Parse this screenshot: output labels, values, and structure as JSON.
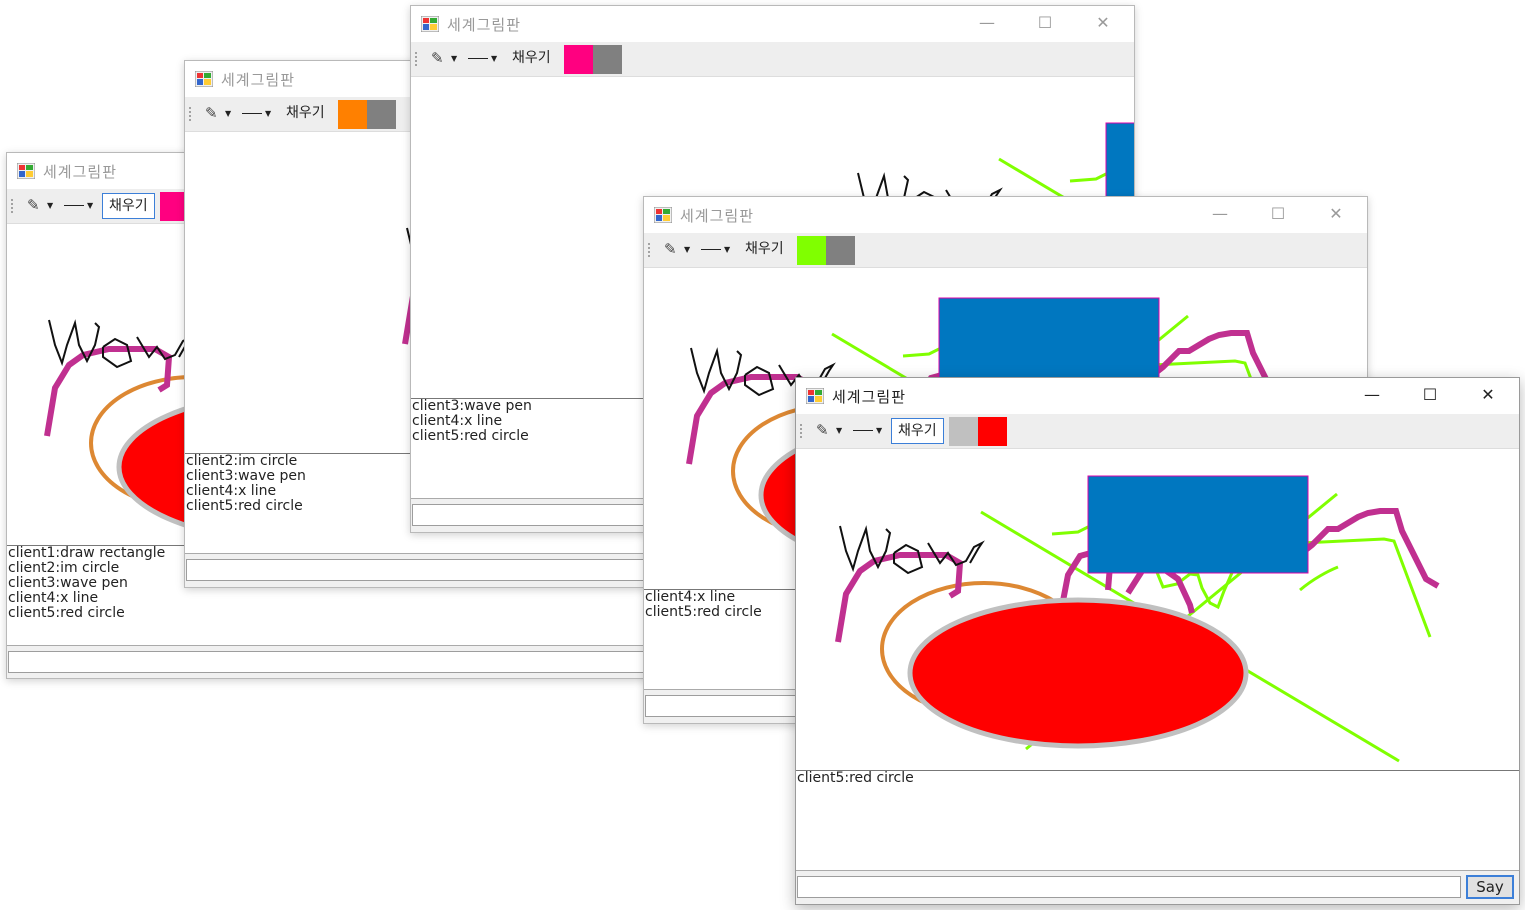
{
  "app": {
    "title": "세계그림판",
    "minimize_icon": "minimize-icon",
    "maximize_icon": "maximize-icon",
    "close_icon": "close-icon",
    "say_label": "Say"
  },
  "toolbar": {
    "pen_icon": "pen-icon",
    "line_width_icon": "line-width-icon",
    "fill_label": "채우기"
  },
  "windows": [
    {
      "id": "client1",
      "colors": [
        "#ff0080",
        "#808080"
      ],
      "log": [
        "client1:draw rectangle",
        "client2:im circle",
        "client3:wave pen",
        "client4:x line",
        "client5:red circle"
      ]
    },
    {
      "id": "client2",
      "colors": [
        "#ff8000",
        "#808080"
      ],
      "log": [
        "client2:im circle",
        "client3:wave pen",
        "client4:x line",
        "client5:red circle"
      ]
    },
    {
      "id": "client3",
      "colors": [
        "#ff0080",
        "#808080"
      ],
      "log": [
        "client3:wave pen",
        "client4:x line",
        "client5:red circle"
      ]
    },
    {
      "id": "client4",
      "colors": [
        "#80ff00",
        "#808080"
      ],
      "log": [
        "client4:x line",
        "client5:red circle"
      ]
    },
    {
      "id": "client5",
      "colors": [
        "#c0c0c0",
        "#ff0000"
      ],
      "log": [
        "client5:red circle"
      ]
    }
  ]
}
